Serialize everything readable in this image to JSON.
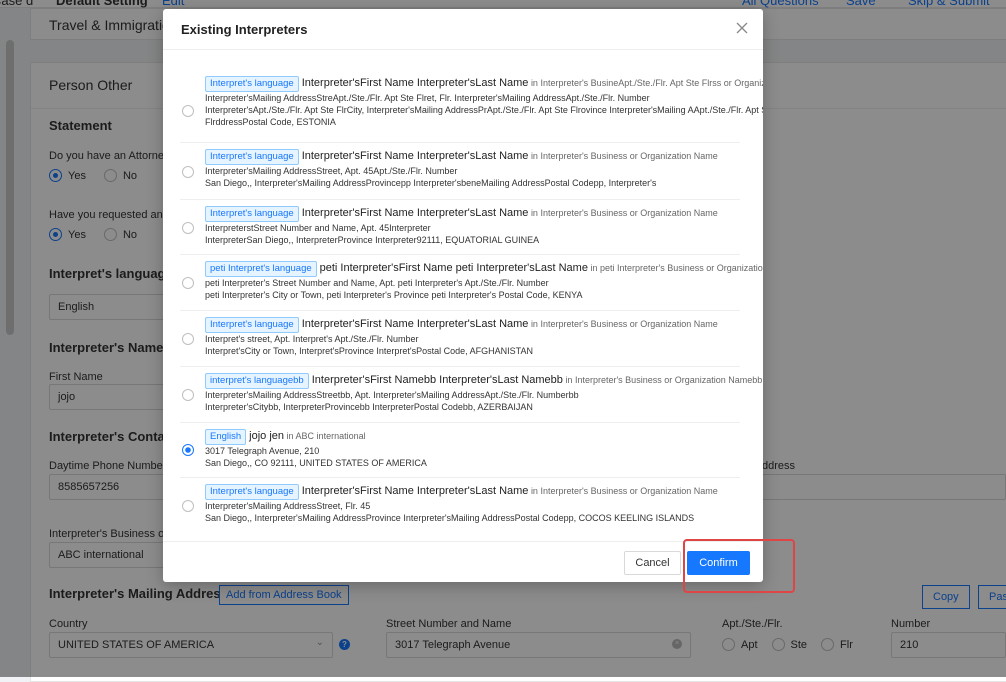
{
  "topbar": {
    "left_text": "Case d",
    "tab1": "Default Setting",
    "tab2": "Edit",
    "link1": "All Questions",
    "link2": "Save",
    "link3": "Skip & Submit"
  },
  "background": {
    "section_travel": "Travel & Immigration",
    "section_person_other": "Person Other",
    "statement_title": "Statement",
    "q_attorney": "Do you have an Attorney",
    "q_requested": "Have you requested an",
    "yes": "Yes",
    "no": "No",
    "interp_language_title": "Interpret's language",
    "interp_language_value": "English",
    "interp_name_title": "Interpreter's Name",
    "first_name_label": "First Name",
    "first_name_value": "jojo",
    "contact_title": "Interpreter's Contact",
    "daytime_label": "Daytime Phone Number",
    "daytime_value": "8585657256",
    "email_label_partial": "ddress",
    "business_label": "Interpreter's Business o",
    "business_value": "ABC international",
    "mailing_title": "Interpreter's Mailing Address",
    "add_from_book": "Add from Address Book",
    "copy": "Copy",
    "paste_partial": "Pas",
    "country_label": "Country",
    "country_value": "UNITED STATES OF AMERICA",
    "street_label": "Street Number and Name",
    "street_value": "3017 Telegraph Avenue",
    "apt_label": "Apt./Ste./Flr.",
    "apt": "Apt",
    "ste": "Ste",
    "flr": "Flr",
    "number_label": "Number",
    "number_value": "210"
  },
  "modal": {
    "title": "Existing Interpreters",
    "cancel": "Cancel",
    "confirm": "Confirm",
    "items": [
      {
        "tag": "Interpret's language",
        "name": "Interpreter'sFirst Name Interpreter'sLast Name",
        "org": "in Interpreter's BusineApt./Ste./Flr. Apt Ste Flrss or Organization Name",
        "line1": "Interpreter'sMailing AddressStreApt./Ste./Flr.  Apt Ste Flret, Flr. Interpreter'sMailing AddressApt./Ste./Flr. Number",
        "line2": "Interpreter'sApt./Ste./Flr.  Apt Ste FlrCity, Interpreter'sMailing AddressPrApt./Ste./Flr.  Apt Ste Flrovince Interpreter'sMailing AApt./Ste./Flr.  Apt Ste",
        "line3": "FlrddressPostal Code, ESTONIA",
        "selected": false
      },
      {
        "tag": "Interpret's language",
        "name": "Interpreter'sFirst Name Interpreter'sLast Name",
        "org": "in Interpreter's Business or Organization Name",
        "line1": "Interpreter'sMailing AddressStreet, Apt. 45Apt./Ste./Flr. Number",
        "line2": "San Diego,, Interpreter'sMailing AddressProvincepp Interpreter'sbeneMailing AddressPostal Codepp, Interpreter's",
        "line3": "",
        "selected": false
      },
      {
        "tag": "Interpret's language",
        "name": "Interpreter'sFirst Name Interpreter'sLast Name",
        "org": "in Interpreter's Business or Organization Name",
        "line1": "InterpreterstStreet Number and Name, Apt. 45Interpreter",
        "line2": "InterpreterSan Diego,, InterpreterProvince Interpreter92111, EQUATORIAL GUINEA",
        "line3": "",
        "selected": false
      },
      {
        "tag": "peti Interpret's language",
        "name": "peti Interpreter'sFirst Name peti Interpreter'sLast Name",
        "org": "in peti Interpreter's Business or Organization Name",
        "line1": "peti Interpreter's Street Number and Name, Apt. peti Interpreter's Apt./Ste./Flr. Number",
        "line2": "peti Interpreter's City or Town, peti Interpreter's Province peti Interpreter's Postal Code, KENYA",
        "line3": "",
        "selected": false
      },
      {
        "tag": "Interpret's language",
        "name": "Interpreter'sFirst Name Interpreter'sLast Name",
        "org": "in Interpreter's Business or Organization Name",
        "line1": "Interpret's street, Apt. Interpret's Apt./Ste./Flr. Number",
        "line2": "Interpret'sCity or Town, Interpret'sProvince Interpret'sPostal Code, AFGHANISTAN",
        "line3": "",
        "selected": false
      },
      {
        "tag": "interpret's languagebb",
        "name": "Interpreter'sFirst Namebb Interpreter'sLast Namebb",
        "org": "in Interpreter's Business or Organization Namebb",
        "line1": "Interpreter'sMailing AddressStreetbb, Apt. Interpreter'sMailing AddressApt./Ste./Flr. Numberbb",
        "line2": "Interpreter'sCitybb, InterpreterProvincebb InterpreterPostal Codebb, AZERBAIJAN",
        "line3": "",
        "selected": false
      },
      {
        "tag": "English",
        "name": "jojo jen",
        "org": "in ABC international",
        "line1": "3017 Telegraph Avenue,  210",
        "line2": "San Diego,, CO 92111, UNITED STATES OF AMERICA",
        "line3": "",
        "selected": true
      },
      {
        "tag": "Interpret's language",
        "name": "Interpreter'sFirst Name Interpreter'sLast Name",
        "org": "in Interpreter's Business or Organization Name",
        "line1": "Interpreter'sMailing AddressStreet, Flr. 45",
        "line2": "San Diego,, Interpreter'sMailing AddressProvince Interpreter'sMailing AddressPostal Codepp, COCOS KEELING ISLANDS",
        "line3": "",
        "selected": false
      }
    ]
  },
  "colors": {
    "accent": "#1677ff",
    "highlight": "#e04545",
    "overlay": "rgba(0,0,0,0.45)"
  }
}
